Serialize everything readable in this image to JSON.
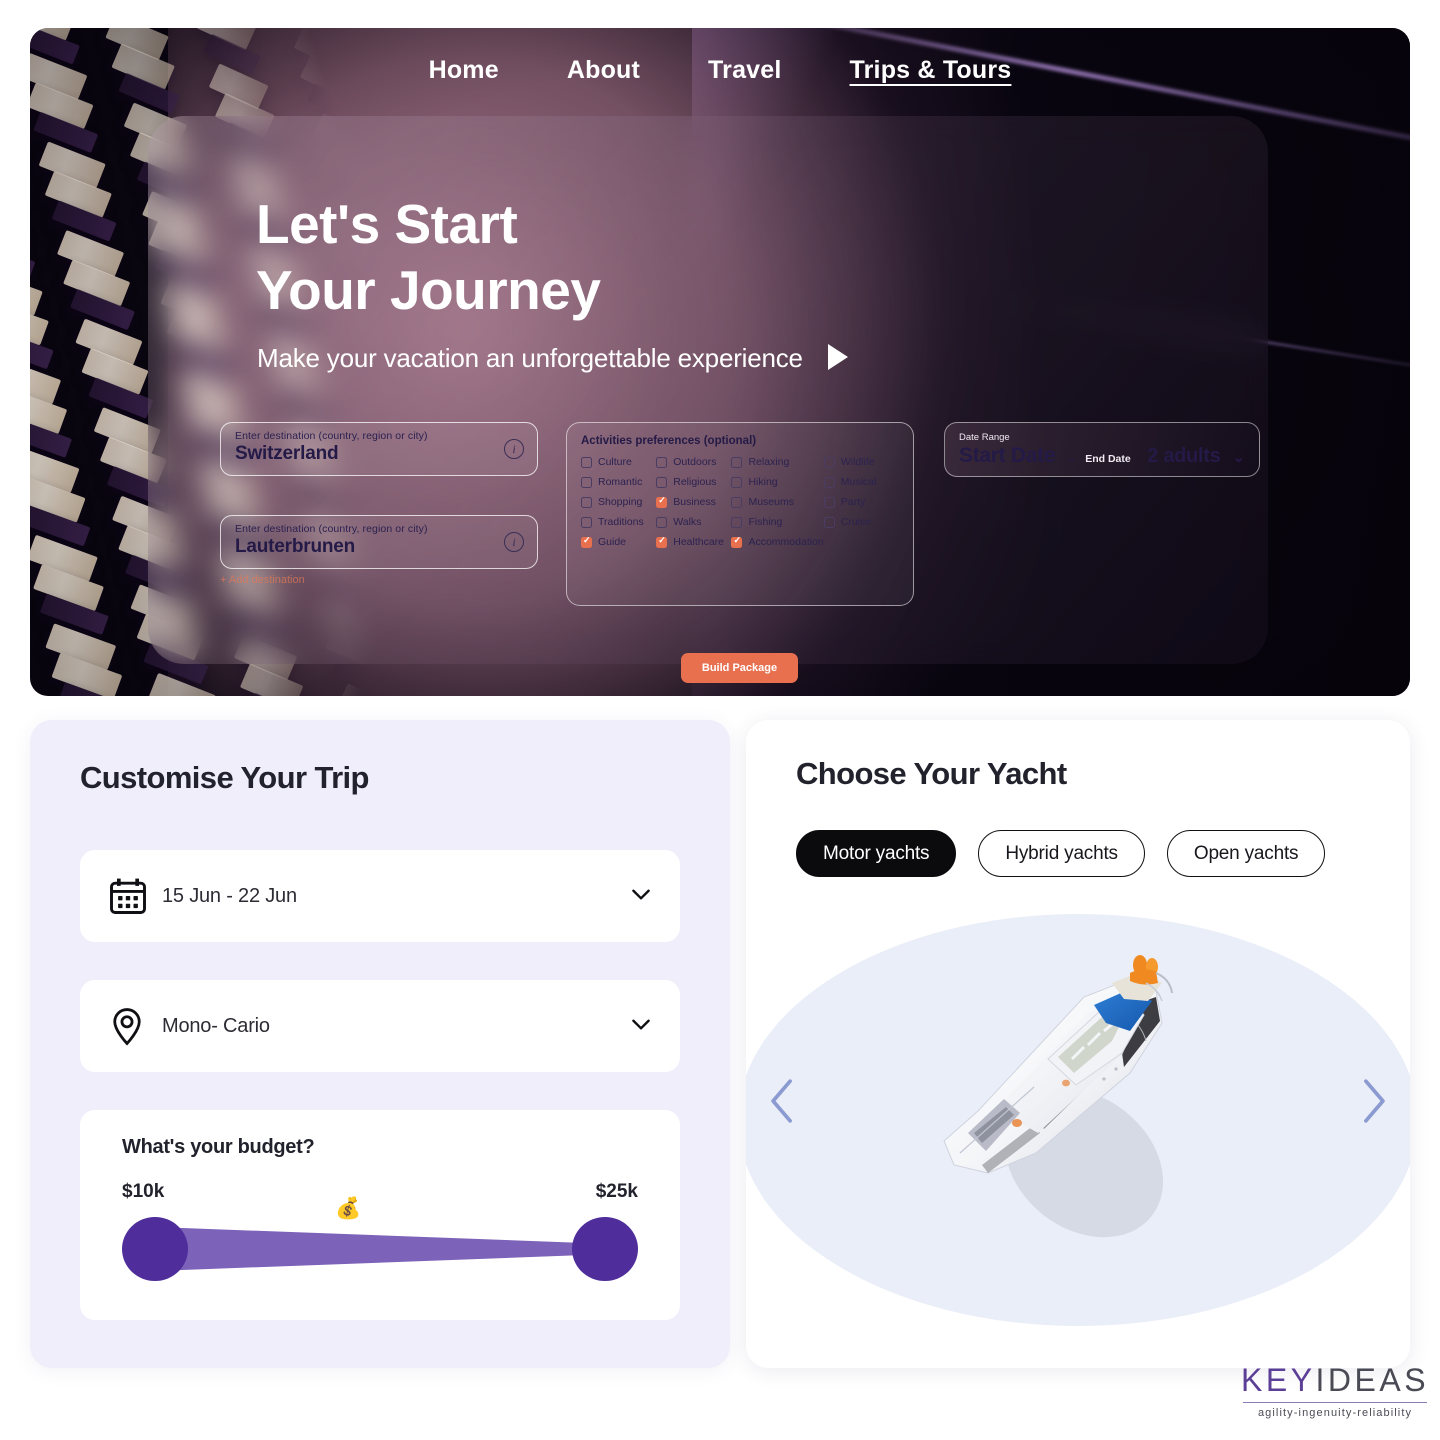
{
  "nav": {
    "items": [
      {
        "label": "Home",
        "active": false
      },
      {
        "label": "About",
        "active": false
      },
      {
        "label": "Travel",
        "active": false
      },
      {
        "label": "Trips & Tours",
        "active": true
      }
    ]
  },
  "hero": {
    "title": "Let's Start\nYour Journey",
    "subtitle": "Make your vacation an unforgettable experience",
    "play_icon": "play-icon",
    "destinations": [
      {
        "label": "Enter destination (country, region or city)",
        "value": "Switzerland",
        "info_icon": "info-icon"
      },
      {
        "label": "Enter destination (country, region or city)",
        "value": "Lauterbrunen",
        "info_icon": "info-icon"
      }
    ],
    "add_destination": "+ Add destination",
    "activities": {
      "title": "Activities preferences (optional)",
      "options": [
        {
          "label": "Culture",
          "checked": false
        },
        {
          "label": "Outdoors",
          "checked": false
        },
        {
          "label": "Relaxing",
          "checked": false
        },
        {
          "label": "Wildlife",
          "checked": false
        },
        {
          "label": "Romantic",
          "checked": false
        },
        {
          "label": "Religious",
          "checked": false
        },
        {
          "label": "Hiking",
          "checked": false
        },
        {
          "label": "Musical",
          "checked": false
        },
        {
          "label": "Shopping",
          "checked": false
        },
        {
          "label": "Business",
          "checked": true
        },
        {
          "label": "Museums",
          "checked": false
        },
        {
          "label": "Party",
          "checked": false
        },
        {
          "label": "Traditions",
          "checked": false
        },
        {
          "label": "Walks",
          "checked": false
        },
        {
          "label": "Fishing",
          "checked": false
        },
        {
          "label": "Cruise",
          "checked": false
        },
        {
          "label": "Guide",
          "checked": true
        },
        {
          "label": "Healthcare",
          "checked": true
        },
        {
          "label": "Accommodation",
          "checked": true
        }
      ]
    },
    "date_range": {
      "label": "Date Range",
      "start": "Start Date",
      "arrow": "→",
      "end": "End Date",
      "guests": "2 adults",
      "chevron_icon": "chevron-down-icon"
    },
    "build_button": "Build Package"
  },
  "customise": {
    "title": "Customise Your Trip",
    "date_field": {
      "icon": "calendar-icon",
      "value": "15 Jun - 22 Jun",
      "chevron_icon": "chevron-down-icon"
    },
    "location_field": {
      "icon": "map-pin-icon",
      "value": "Mono- Cario",
      "chevron_icon": "chevron-down-icon"
    },
    "budget": {
      "question": "What's your budget?",
      "min": "$10k",
      "max": "$25k",
      "emoji": "💰"
    }
  },
  "yacht": {
    "title": "Choose Your Yacht",
    "tabs": [
      {
        "label": "Motor yachts",
        "active": true
      },
      {
        "label": "Hybrid yachts",
        "active": false
      },
      {
        "label": "Open yachts",
        "active": false
      }
    ],
    "prev_icon": "chevron-left-icon",
    "next_icon": "chevron-right-icon",
    "image_alt": "motor-yacht"
  },
  "logo": {
    "part1": "KEY",
    "part2": "IDEAS",
    "tagline": "agility-ingenuity-reliability"
  },
  "colors": {
    "accent_orange": "#e8704f",
    "purple_dark": "#4f2e9b",
    "purple_light": "#7c62b8",
    "card_lavender": "#f1eefc",
    "brand_purple": "#5b3f96"
  }
}
